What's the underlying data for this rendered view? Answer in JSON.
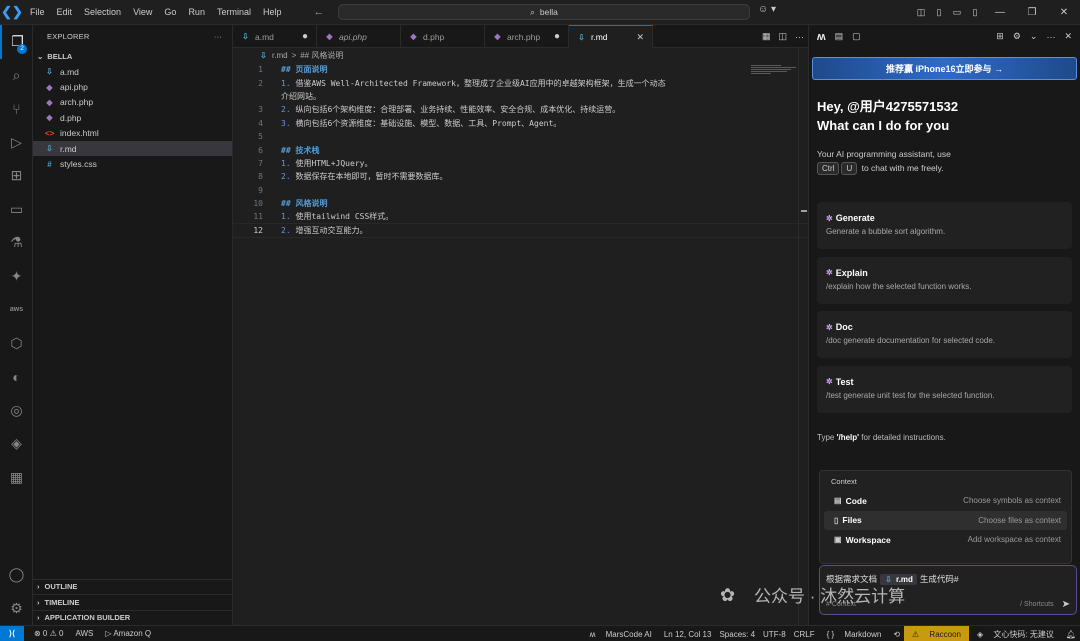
{
  "titlebar": {
    "menu": [
      "File",
      "Edit",
      "Selection",
      "View",
      "Go",
      "Run",
      "Terminal",
      "Help"
    ],
    "search": "bella"
  },
  "explorer": {
    "header": "EXPLORER",
    "folder": "BELLA",
    "files": [
      {
        "name": "a.md",
        "type": "md"
      },
      {
        "name": "api.php",
        "type": "php"
      },
      {
        "name": "arch.php",
        "type": "php"
      },
      {
        "name": "d.php",
        "type": "php"
      },
      {
        "name": "index.html",
        "type": "html"
      },
      {
        "name": "r.md",
        "type": "md",
        "selected": true
      },
      {
        "name": "styles.css",
        "type": "css"
      }
    ],
    "sections": [
      "OUTLINE",
      "TIMELINE",
      "APPLICATION BUILDER"
    ]
  },
  "activity_badge": "2",
  "tabs": [
    {
      "label": "a.md",
      "icon": "md",
      "modified": true
    },
    {
      "label": "api.php",
      "icon": "php",
      "italic": true
    },
    {
      "label": "d.php",
      "icon": "php"
    },
    {
      "label": "arch.php",
      "icon": "php",
      "modified": true
    },
    {
      "label": "r.md",
      "icon": "md",
      "active": true
    }
  ],
  "breadcrumb": {
    "file": "r.md",
    "sep": ">",
    "section": "## 风格说明"
  },
  "code_lines": [
    {
      "n": "1",
      "heading": "## 页面说明"
    },
    {
      "n": "2",
      "list": "1.",
      "text": "借鉴AWS Well-Architected Framework，整理成了企业级AI应用中的卓越架构框架，生成一个动态",
      "cont": "介绍网站。"
    },
    {
      "n": "3",
      "list": "2.",
      "text": "纵向包括6个架构维度：合理部署、业务持续、性能效率、安全合规、成本优化、持续运营。"
    },
    {
      "n": "4",
      "list": "3.",
      "text": "横向包括6个资源维度：基础设施、模型、数据、工具、Prompt、Agent。"
    },
    {
      "n": "5",
      "text": ""
    },
    {
      "n": "6",
      "heading": "## 技术栈"
    },
    {
      "n": "7",
      "list": "1.",
      "text": "使用HTML+JQuery。"
    },
    {
      "n": "8",
      "list": "2.",
      "text": "数据保存在本地即可，暂时不需要数据库。"
    },
    {
      "n": "9",
      "text": ""
    },
    {
      "n": "10",
      "heading": "## 风格说明"
    },
    {
      "n": "11",
      "list": "1.",
      "text": "使用tailwind CSS样式。"
    },
    {
      "n": "12",
      "list": "2.",
      "text": "增强互动交互能力。",
      "current": true
    }
  ],
  "panel": {
    "promo": "推荐赢 iPhone16立即参与 →",
    "greeting_line1": "Hey, @用户4275571532",
    "greeting_line2": "What can I do for you",
    "intro_line1": "Your AI programming assistant, use",
    "kbd1": "Ctrl",
    "kbd2": "U",
    "intro_line2": "to chat with me freely.",
    "cards": [
      {
        "title": "Generate",
        "desc": "Generate a bubble sort algorithm."
      },
      {
        "title": "Explain",
        "desc": "/explain how the selected function works."
      },
      {
        "title": "Doc",
        "desc": "/doc generate documentation for selected code."
      },
      {
        "title": "Test",
        "desc": "/test generate unit test for the selected function."
      }
    ],
    "help_prefix": "Type",
    "help_cmd": "'/help'",
    "help_suffix": "for detailed instructions.",
    "context": {
      "title": "Context",
      "rows": [
        {
          "label": "Code",
          "hint": "Choose symbols as context"
        },
        {
          "label": "Files",
          "hint": "Choose files as context",
          "highlighted": true
        },
        {
          "label": "Workspace",
          "hint": "Add workspace as context"
        }
      ]
    },
    "input": {
      "prefix": "根据需求文档",
      "chip": "r.md",
      "suffix": "生成代码#",
      "hint_left": "# Context",
      "hint_right": "/ Shortcuts"
    }
  },
  "watermark": "公众号 · 沐然云计算",
  "statusbar": {
    "problems": "⊗ 0 ⚠ 0",
    "aws": "AWS",
    "amazonq": "▷ Amazon Q",
    "marscode": "MarsCode AI",
    "position": "Ln 12, Col 13",
    "spaces": "Spaces: 4",
    "encoding": "UTF-8",
    "eol": "CRLF",
    "language": "Markdown",
    "raccoon": "Raccoon",
    "wenxin": "文心快码: 无建议"
  },
  "colors": {
    "accent": "#0078d4",
    "heading": "#569cd6",
    "promo": "#2f6ac8"
  }
}
